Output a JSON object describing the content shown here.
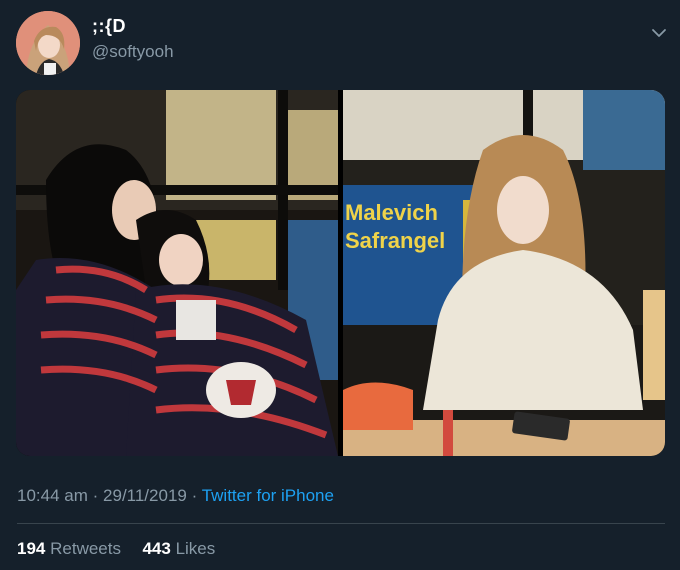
{
  "user": {
    "display_name": ";:{D",
    "handle": "@softyooh"
  },
  "tweet": {
    "time": "10:44 am",
    "sep1": "·",
    "date": "29/11/2019",
    "sep2": "·",
    "source": "Twitter for iPhone"
  },
  "stats": {
    "retweets_count": "194",
    "retweets_label": "Retweets",
    "likes_count": "443",
    "likes_label": "Likes"
  },
  "photo_right": {
    "sign_line1": "Malevich",
    "sign_line2": "Safrangel"
  },
  "colors": {
    "background": "#15202b",
    "secondary_text": "#8899a6",
    "link": "#1da1f2",
    "divider": "#38444d"
  },
  "icons": {
    "menu": "chevron-down-icon"
  }
}
